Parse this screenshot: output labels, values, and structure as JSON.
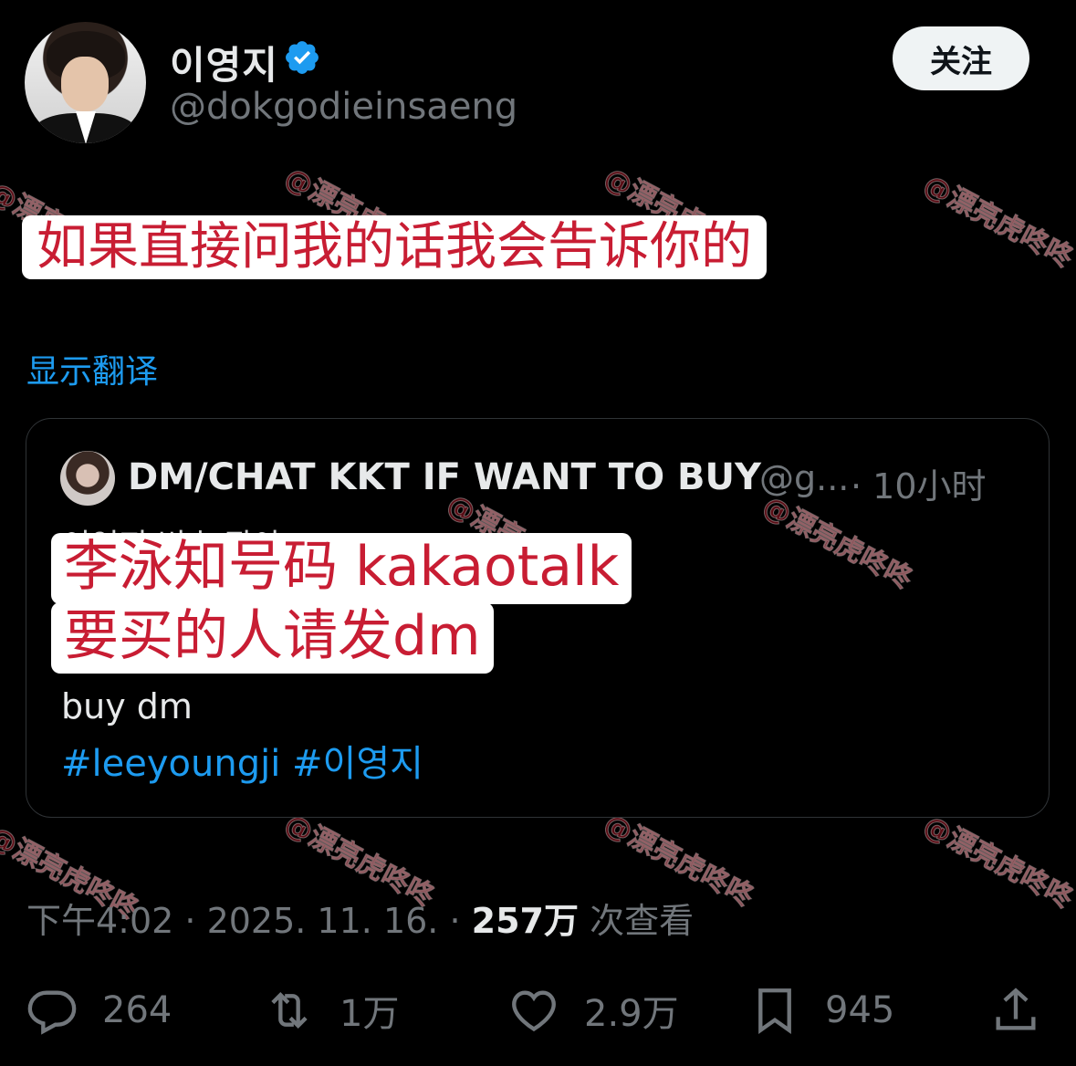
{
  "user": {
    "name": "이영지",
    "handle": "@dokgodieinsaeng",
    "follow_label": "关注"
  },
  "tweet": {
    "text_overlay": "如果直接问我的话我会告诉你的",
    "translate_label": "显示翻译"
  },
  "quote": {
    "name": "DM/CHAT KKT IF WANT TO BUY",
    "handle": "@g...",
    "time": "· 10小时",
    "hidden_text": "이영지 번호 팔아",
    "overlay_line1": "李泳知号码 kakaotalk",
    "overlay_line2": "要买的人请发dm",
    "buy_text": "buy dm",
    "tag1": "#leeyoungji",
    "tag2": "#이영지"
  },
  "meta": {
    "time": "下午4:02 · 2025. 11. 16. ·",
    "views_count": "257万",
    "views_label": "次查看"
  },
  "actions": {
    "reply_count": "264",
    "retweet_count": "1万",
    "like_count": "2.9万",
    "bookmark_count": "945"
  },
  "watermark": "@漂亮虎咚咚",
  "colors": {
    "accent": "#1d9bf0",
    "overlay_text": "#c81d33",
    "muted": "#71767b"
  }
}
